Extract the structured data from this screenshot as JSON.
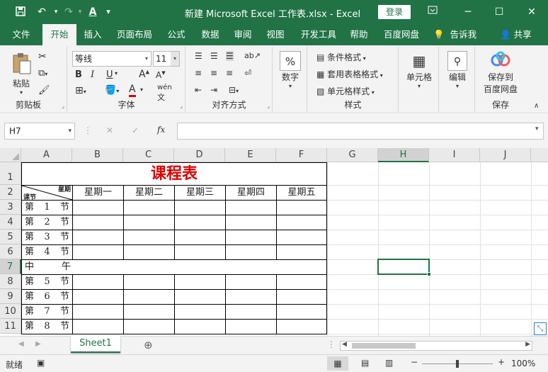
{
  "titlebar": {
    "title": "新建 Microsoft Excel 工作表.xlsx  -  Excel",
    "login_label": "登录",
    "save_icon": "save-icon",
    "undo_icon": "undo-icon",
    "redo_icon": "redo-icon"
  },
  "tabs": [
    "文件",
    "开始",
    "插入",
    "页面布局",
    "公式",
    "数据",
    "审阅",
    "视图",
    "开发工具",
    "帮助",
    "百度网盘"
  ],
  "tell_me": "告诉我",
  "share": "共享",
  "ribbon": {
    "clipboard": {
      "paste": "粘贴",
      "label": "剪贴板"
    },
    "font": {
      "name": "等线",
      "size": "11",
      "bold": "B",
      "italic": "I",
      "underline": "U",
      "grow": "A",
      "shrink": "A",
      "color": "A",
      "wen": "wén",
      "label": "字体"
    },
    "alignment": {
      "label": "对齐方式"
    },
    "number": {
      "button": "数字",
      "symbol": "%"
    },
    "styles": {
      "conditional": "条件格式",
      "table": "套用表格格式",
      "cell": "单元格样式",
      "label": "样式"
    },
    "cells": {
      "button": "单元格"
    },
    "editing": {
      "button": "编辑"
    },
    "save": {
      "line1": "保存到",
      "line2": "百度网盘",
      "label": "保存"
    }
  },
  "formula_bar": {
    "namebox": "H7",
    "fx": "fx",
    "cancel": "✕",
    "confirm": "✓",
    "value": ""
  },
  "columns": [
    "A",
    "B",
    "C",
    "D",
    "E",
    "F",
    "G",
    "H",
    "I",
    "J"
  ],
  "rows": [
    "1",
    "2",
    "3",
    "4",
    "5",
    "6",
    "7",
    "8",
    "9",
    "10",
    "11"
  ],
  "schedule": {
    "title": "课程表",
    "header_top": "星期",
    "header_bottom": "课节",
    "days": [
      "星期一",
      "星期二",
      "星期三",
      "星期四",
      "星期五"
    ],
    "lessons": [
      [
        "第",
        "1",
        "节"
      ],
      [
        "第",
        "2",
        "节"
      ],
      [
        "第",
        "3",
        "节"
      ],
      [
        "第",
        "4",
        "节"
      ],
      [
        "中",
        "",
        "午"
      ],
      [
        "第",
        "5",
        "节"
      ],
      [
        "第",
        "6",
        "节"
      ],
      [
        "第",
        "7",
        "节"
      ],
      [
        "第",
        "8",
        "节"
      ]
    ]
  },
  "sheet_tab": "Sheet1",
  "status": {
    "ready": "就绪",
    "zoom": "100%",
    "zoom_minus": "−",
    "zoom_plus": "+"
  },
  "colors": {
    "accent": "#217346",
    "title_red": "#e00000"
  }
}
